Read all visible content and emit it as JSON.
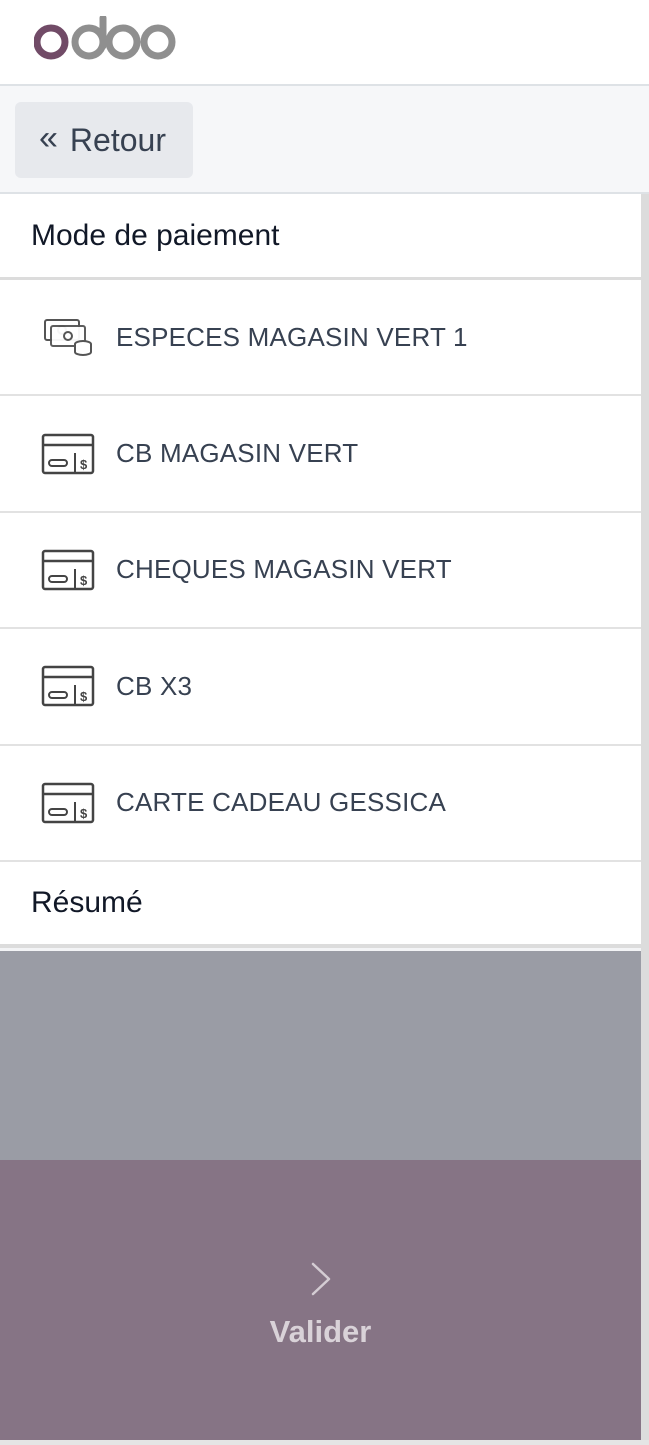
{
  "brand": {
    "logo_text": "odoo",
    "colors": {
      "primary": "#714B67",
      "grey": "#8F8F8F"
    }
  },
  "back_button": {
    "label": "Retour",
    "icon": "double-chevron-left-icon"
  },
  "payment_section": {
    "title": "Mode de paiement",
    "methods": [
      {
        "label": "ESPECES MAGASIN VERT 1",
        "icon": "cash-icon"
      },
      {
        "label": "CB MAGASIN VERT",
        "icon": "card-icon"
      },
      {
        "label": "CHEQUES MAGASIN VERT",
        "icon": "card-icon"
      },
      {
        "label": "CB X3",
        "icon": "card-icon"
      },
      {
        "label": "CARTE CADEAU GESSICA",
        "icon": "card-icon"
      }
    ]
  },
  "summary_section": {
    "title": "Résumé"
  },
  "validate_button": {
    "label": "Valider",
    "icon": "chevron-right-icon"
  }
}
